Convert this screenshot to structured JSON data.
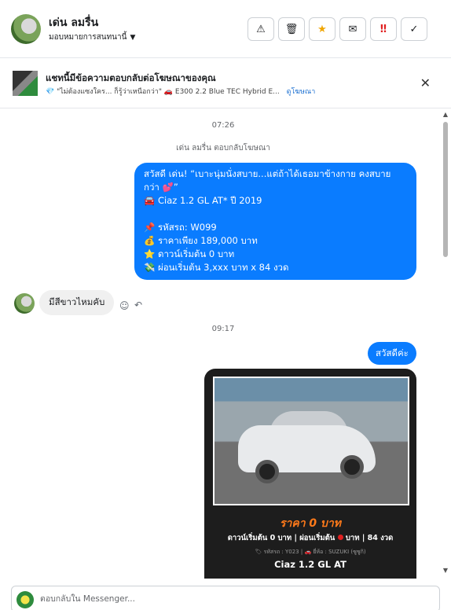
{
  "header": {
    "contact_name": "เด่น ลมรื่น",
    "assign_label": "มอบหมายการสนทนานี้",
    "caret_icon": "chevron-down-icon",
    "actions": [
      {
        "icon": "warning-icon",
        "glyph": "⚠"
      },
      {
        "icon": "trash-icon",
        "glyph": "🗑"
      },
      {
        "icon": "star-icon",
        "glyph": "★"
      },
      {
        "icon": "mark-unread-icon",
        "glyph": "✉"
      },
      {
        "icon": "important-icon",
        "glyph": "‼"
      },
      {
        "icon": "check-icon",
        "glyph": "✓"
      }
    ]
  },
  "ad_context": {
    "title": "แชทนี้มีข้อความตอบกลับต่อโฆษณาของคุณ",
    "subtitle": "💎 \"ไม่ต้องแซงใคร... ก็รู้ว่าเหนือกว่า\" 🚗 E300 2.2 Blue TEC Hybrid E...",
    "link_label": "ดูโฆษณา",
    "close_glyph": "✕"
  },
  "thread": {
    "time_1": "07:26",
    "reply_meta": "เด่น ลมรื่น ตอบกลับโฆษณา",
    "ad_message_lines": [
      "สวัสดี เด่น! “เบาะนุ่มนั่งสบาย...แต่ถ้าได้เธอมาข้างกาย คงสบาย",
      "กว่า 💕”",
      "🚘 Ciaz 1.2 GL AT* ปี 2019",
      "",
      "📌 รหัสรถ: W099",
      "💰 ราคาเพียง 189,000 บาท",
      "⭐ ดาวน์เริ่มต้น 0 บาท",
      "💸 ผ่อนเริ่มต้น 3,xxx บาท x 84 งวด"
    ],
    "incoming_message": "มีสีขาวไหมคับ",
    "time_2": "09:17",
    "outgoing_greeting": "สวัสดีค่ะ",
    "card": {
      "price": "ราคา 0 บาท",
      "terms_left": "ดาวน์เริ่มต้น 0 บาท | ผ่อนเริ่มต้น",
      "terms_right": "บาท | 84 งวด",
      "code_line": "🏷 รหัสรถ : Y023 | 🚗 ยี่ห้อ : SUZUKI (ซูซูกิ)",
      "model": "Ciaz 1.2 GL AT"
    }
  },
  "reply": {
    "placeholder": "ตอบกลับใน Messenger..."
  },
  "colors": {
    "outgoing_bubble": "#0a7cff",
    "card_background": "#1d1d1d",
    "price_orange": "#ff7a1a"
  }
}
